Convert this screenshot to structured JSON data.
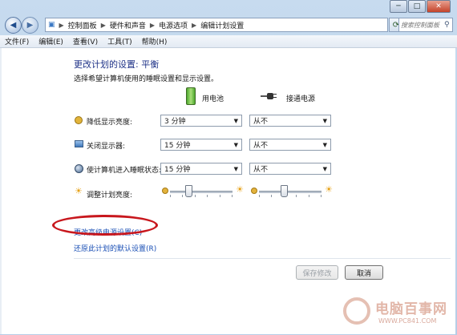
{
  "window": {
    "controls": {
      "minimize": "─",
      "maximize": "□",
      "close": "✕"
    }
  },
  "nav": {
    "breadcrumb": [
      "控制面板",
      "硬件和声音",
      "电源选项",
      "编辑计划设置"
    ],
    "search_placeholder": "搜索控制面板"
  },
  "menu": [
    "文件(F)",
    "编辑(E)",
    "查看(V)",
    "工具(T)",
    "帮助(H)"
  ],
  "main": {
    "title": "更改计划的设置: 平衡",
    "subtitle": "选择希望计算机使用的睡眠设置和显示设置。",
    "columns": {
      "battery": "用电池",
      "plugged": "接通电源"
    },
    "rows": [
      {
        "label": "降低显示亮度:",
        "battery": "3 分钟",
        "plugged": "从不",
        "icon": "dim-display-icon"
      },
      {
        "label": "关闭显示器:",
        "battery": "15 分钟",
        "plugged": "从不",
        "icon": "monitor-icon"
      },
      {
        "label": "使计算机进入睡眠状态:",
        "battery": "15 分钟",
        "plugged": "从不",
        "icon": "sleep-icon"
      }
    ],
    "brightness": {
      "label": "调整计划亮度:",
      "battery_level": 0.3,
      "plugged_level": 0.4
    },
    "links": {
      "advanced": "更改高级电源设置(C)",
      "restore": "还原此计划的默认设置(R)"
    },
    "buttons": {
      "save": "保存修改",
      "cancel": "取消"
    }
  },
  "watermark": {
    "text": "电脑百事网",
    "url": "WWW.PC841.COM"
  },
  "colors": {
    "heading": "#1e3287",
    "link": "#1a4fb5",
    "annotation": "#c8171d"
  }
}
